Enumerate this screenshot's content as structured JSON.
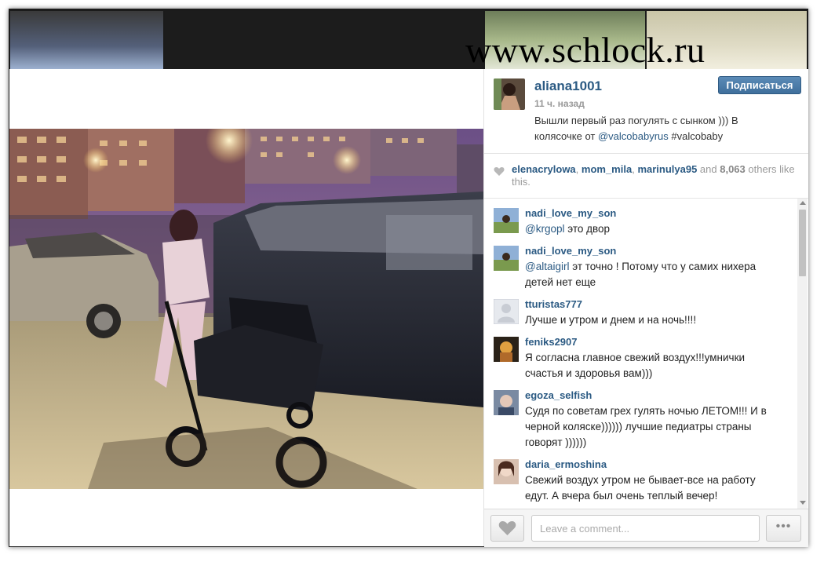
{
  "watermark": "www.schlock.ru",
  "post": {
    "username": "aliana1001",
    "time_ago": "11 ч. назад",
    "follow_label": "Подписаться",
    "caption_part1": "Вышли первый раз погулять с сынком ))) В колясочке от ",
    "caption_mention": "@valcobabyrus",
    "caption_hashtag": " #valcobaby"
  },
  "likes": {
    "user1": "elenacrylowa",
    "sep1": ", ",
    "user2": "mom_mila",
    "sep2": ", ",
    "user3": "marinulya95",
    "and": " and ",
    "count": "8,063",
    "suffix": " others like this."
  },
  "comments": [
    {
      "user": "nadi_love_my_son",
      "mention": "@krgopl",
      "text": " это двор"
    },
    {
      "user": "nadi_love_my_son",
      "mention": "@altaigirl",
      "text": " эт точно ! Потому что у самих нихера детей нет еще"
    },
    {
      "user": "tturistas777",
      "mention": "",
      "text": "Лучше и утром и днем и на ночь!!!!"
    },
    {
      "user": "feniks2907",
      "mention": "",
      "text": "Я согласна главное свежий воздух!!!умнички счастья и здоровья вам)))"
    },
    {
      "user": "egoza_selfish",
      "mention": "",
      "text": "Судя по советам грех гулять ночью ЛЕТОМ!!! И в черной коляске)))))) лучшие педиатры страны говорят ))))))"
    },
    {
      "user": "daria_ermoshina",
      "mention": "",
      "text": "Свежий воздух утром не бывает-все на работу едут. А вчера был очень теплый вечер!"
    }
  ],
  "comment_box": {
    "placeholder": "Leave a comment...",
    "more_label": "•••"
  },
  "colors": {
    "link": "#2b5a83",
    "follow_button": "#3f6f9c"
  }
}
